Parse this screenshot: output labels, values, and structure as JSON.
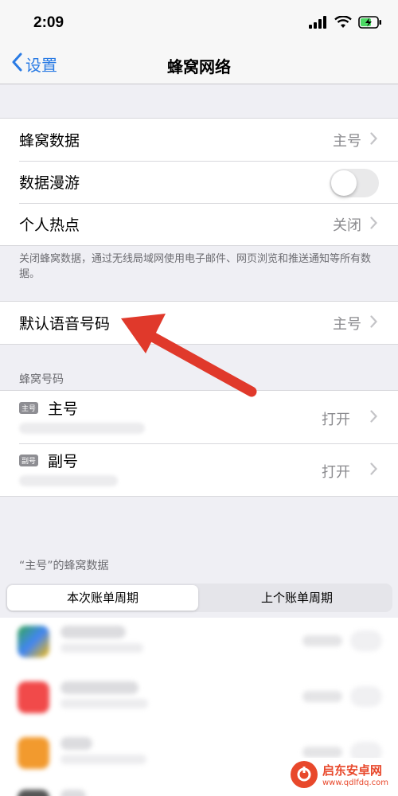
{
  "status_bar": {
    "time": "2:09"
  },
  "nav": {
    "back_label": "设置",
    "title": "蜂窝网络"
  },
  "group1": {
    "rows": [
      {
        "label": "蜂窝数据",
        "value": "主号"
      },
      {
        "label": "数据漫游",
        "toggle": "off"
      },
      {
        "label": "个人热点",
        "value": "关闭"
      }
    ],
    "footer": "关闭蜂窝数据，通过无线局域网使用电子邮件、网页浏览和推送通知等所有数据。"
  },
  "group2": {
    "rows": [
      {
        "label": "默认语音号码",
        "value": "主号"
      }
    ]
  },
  "lines_section": {
    "header": "蜂窝号码",
    "lines": [
      {
        "badge": "主号",
        "name": "主号",
        "value": "打开"
      },
      {
        "badge": "副号",
        "name": "副号",
        "value": "打开"
      }
    ]
  },
  "usage_section": {
    "header": "“主号”的蜂窝数据",
    "segments": [
      "本次账单周期",
      "上个账单周期"
    ],
    "selected_segment": "本次账单周期"
  },
  "watermark": {
    "title": "启东安卓网",
    "url": "www.qdlfdq.com"
  },
  "colors": {
    "accent": "#2a7be4",
    "annotation_arrow": "#e0392b",
    "background": "#efeff4"
  }
}
